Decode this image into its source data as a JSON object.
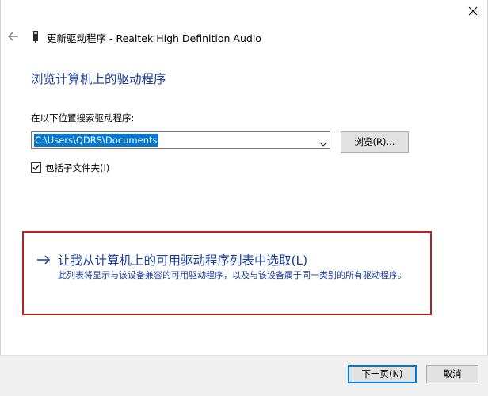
{
  "header": {
    "title": "更新驱动程序 - Realtek High Definition Audio",
    "back_icon": "back-arrow-icon",
    "device_icon": "audio-device-icon",
    "close_icon": "close-icon"
  },
  "main": {
    "heading": "浏览计算机上的驱动程序",
    "search_label": "在以下位置搜索驱动程序:",
    "path_value": "C:\\Users\\QDRS\\Documents",
    "browse_label": "浏览(R)...",
    "include_subfolders": {
      "label": "包括子文件夹(I)",
      "checked": true
    }
  },
  "pick_option": {
    "title": "让我从计算机上的可用驱动程序列表中选取(L)",
    "description": "此列表将显示与该设备兼容的可用驱动程序，以及与该设备属于同一类别的所有驱动程序。"
  },
  "footer": {
    "next_label": "下一页(N)",
    "cancel_label": "取消"
  },
  "colors": {
    "link_blue": "#1a3c9c",
    "selection_blue": "#0078d7",
    "highlight_red": "#b22424"
  }
}
